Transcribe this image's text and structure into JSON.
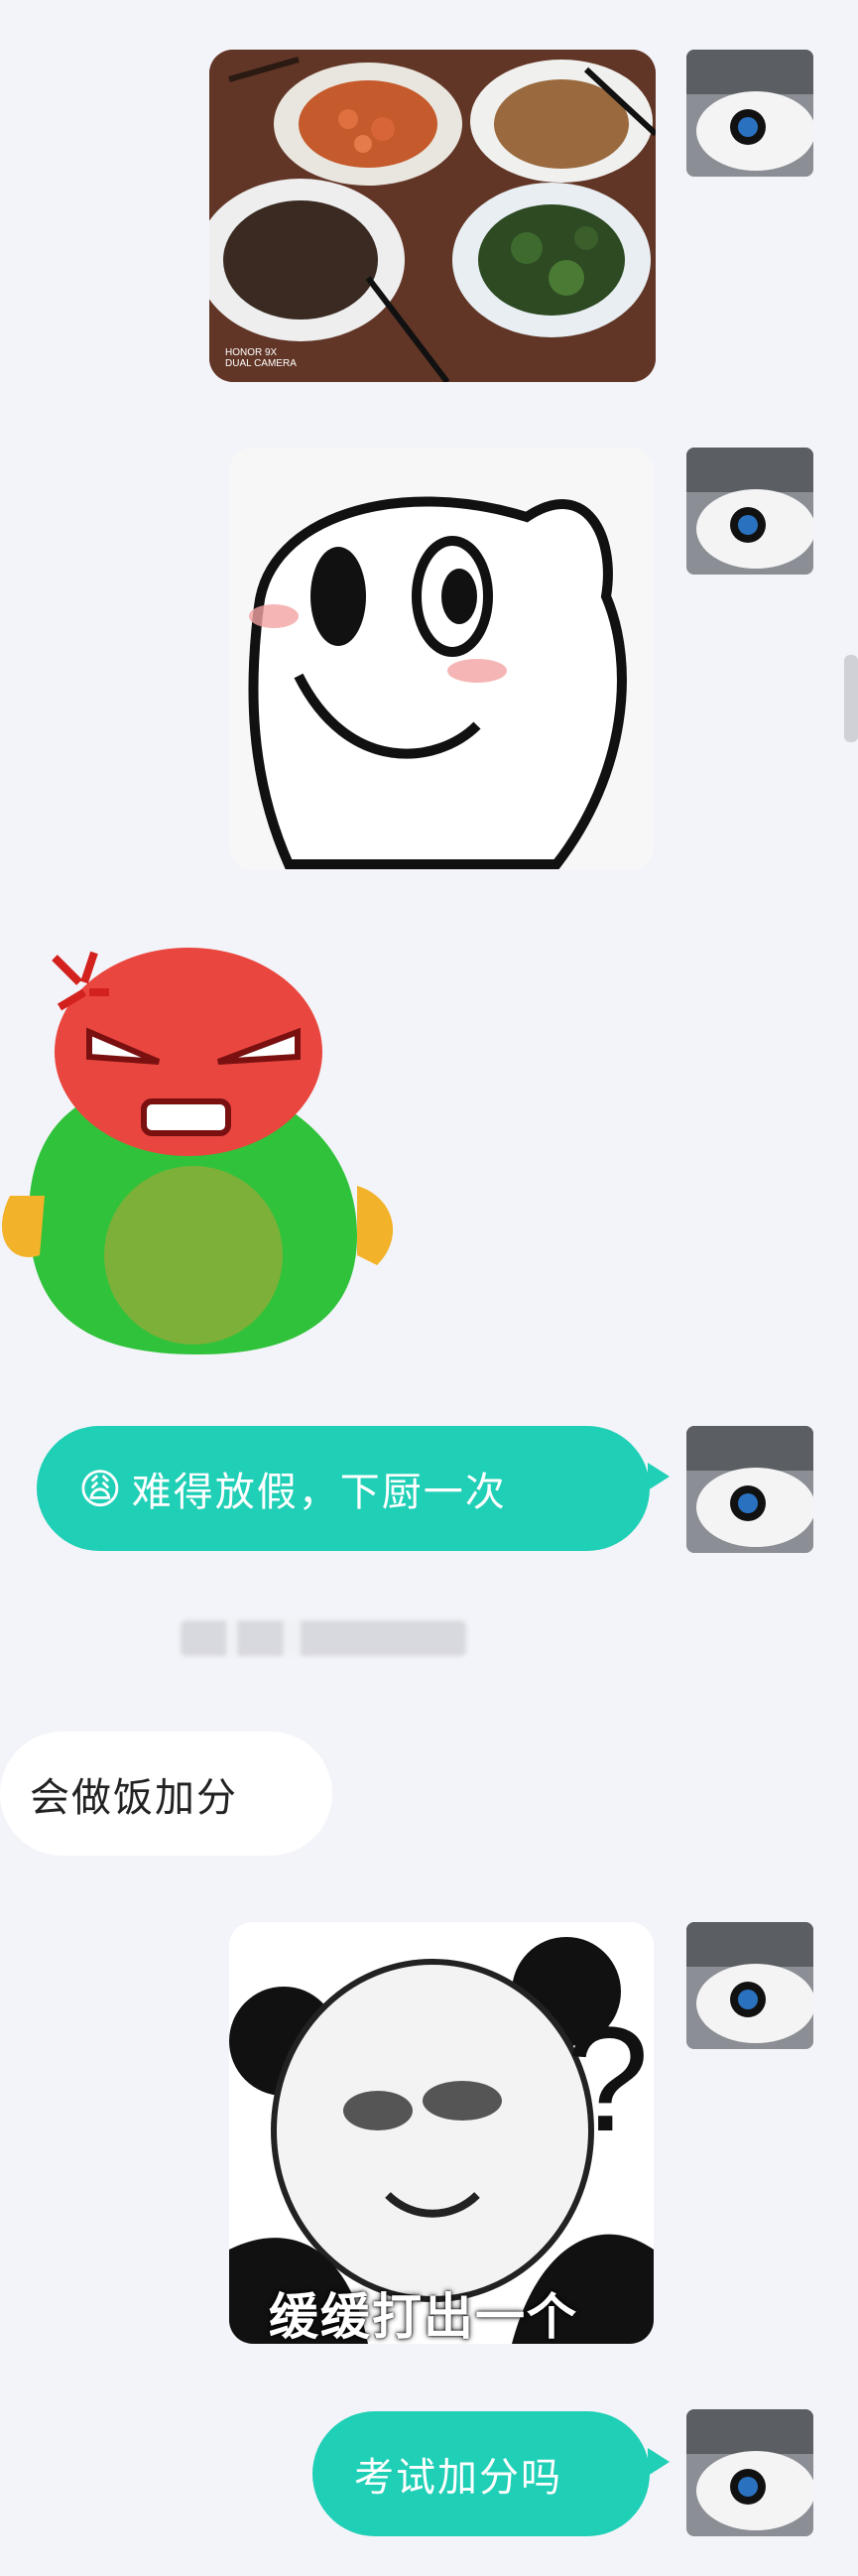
{
  "messages": [
    {
      "id": "m1",
      "side": "right",
      "type": "image",
      "content": "photo-food"
    },
    {
      "id": "m2",
      "side": "right",
      "type": "sticker",
      "content": "cartoon-face"
    },
    {
      "id": "m3",
      "side": "left",
      "type": "sticker",
      "content": "angry-blob"
    },
    {
      "id": "m4",
      "side": "right",
      "type": "text",
      "text": "难得放假，下厨一次",
      "emoji": "😩"
    },
    {
      "id": "m5",
      "side": "left",
      "type": "text",
      "text": "会做饭加分"
    },
    {
      "id": "m6",
      "side": "right",
      "type": "sticker",
      "content": "panda-meme",
      "caption": "缓缓打出一个"
    },
    {
      "id": "m7",
      "side": "right",
      "type": "text",
      "text": "考试加分吗"
    }
  ],
  "photo_watermark": {
    "line1": "HONOR 9X",
    "line2": "DUAL CAMERA"
  },
  "colors": {
    "bubble_right": "#1fcfb6",
    "bubble_left": "#ffffff",
    "background": "#f3f4f9"
  },
  "icons": {
    "avatar": "user-avatar",
    "emoji": "weary-face-emoji"
  }
}
